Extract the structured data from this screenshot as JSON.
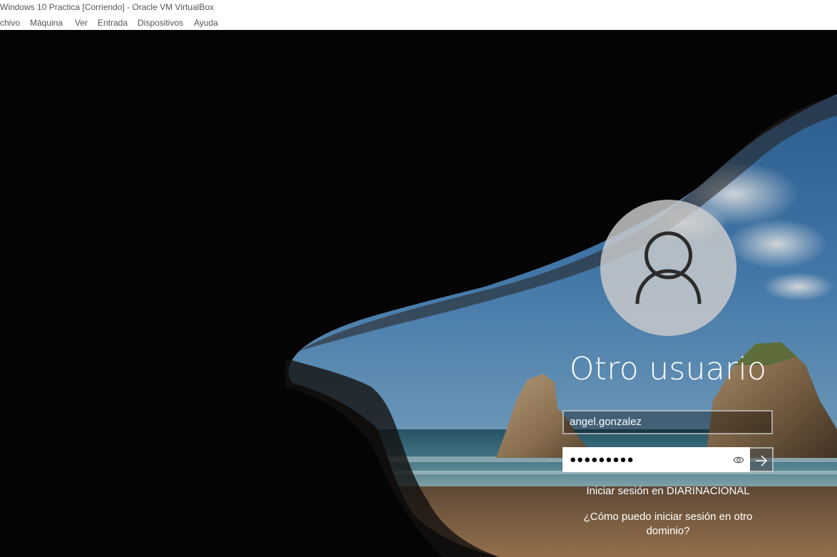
{
  "window": {
    "title": "Windows 10 Practica [Corriendo] - Oracle VM VirtualBox"
  },
  "menubar": {
    "items": [
      "chivo",
      "Máquina",
      "Ver",
      "Entrada",
      "Dispositivos",
      "Ayuda"
    ]
  },
  "login": {
    "user_name": "Otro usuario",
    "username_value": "angel.gonzalez",
    "password_mask": "●●●●●●●●●",
    "domain_text": "Iniciar sesión en DIARINACIONAL",
    "other_domain_link": "¿Cómo puedo iniciar sesión en otro dominio?"
  },
  "icons": {
    "avatar": "user-silhouette-icon",
    "reveal": "eye-icon",
    "submit": "arrow-right-icon"
  }
}
